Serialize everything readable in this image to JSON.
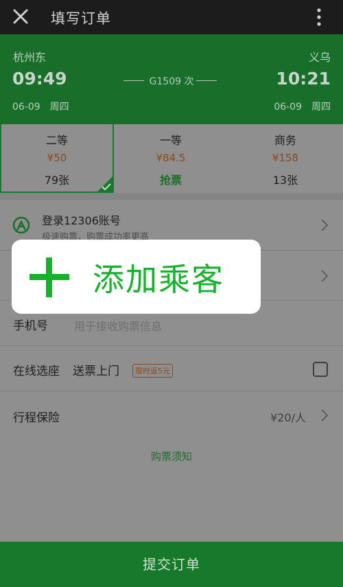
{
  "header": {
    "title": "填写订单",
    "close_icon": "close-icon",
    "more_icon": "more-vertical-icon"
  },
  "train": {
    "from_station": "杭州东",
    "to_station": "义乌",
    "depart_time": "09:49",
    "arrive_time": "10:21",
    "train_no": "G1509 次",
    "depart_date": "06-09　周四",
    "arrive_date": "06-09　周四"
  },
  "seats": [
    {
      "name": "二等",
      "price": "¥50",
      "count": "79张",
      "selected": true
    },
    {
      "name": "一等",
      "price": "¥84.5",
      "count": "抢票",
      "selected": false
    },
    {
      "name": "商务",
      "price": "¥158",
      "count": "13张",
      "selected": false
    }
  ],
  "login": {
    "title": "登录12306账号",
    "subtitle": "极速购票，购票成功率更高"
  },
  "add_passenger": {
    "label": "添加乘客"
  },
  "phone": {
    "label": "手机号",
    "placeholder": "用于接收购票信息"
  },
  "seat_select": {
    "label": "在线选座",
    "label2": "送票上门",
    "badge": "限时返5元"
  },
  "insurance": {
    "label": "行程保险",
    "price": "¥20/人"
  },
  "notice": "购票须知",
  "submit": "提交订单",
  "colors": {
    "green": "#17b22c",
    "dark_green": "#167a2a",
    "price": "#8a4a20"
  }
}
